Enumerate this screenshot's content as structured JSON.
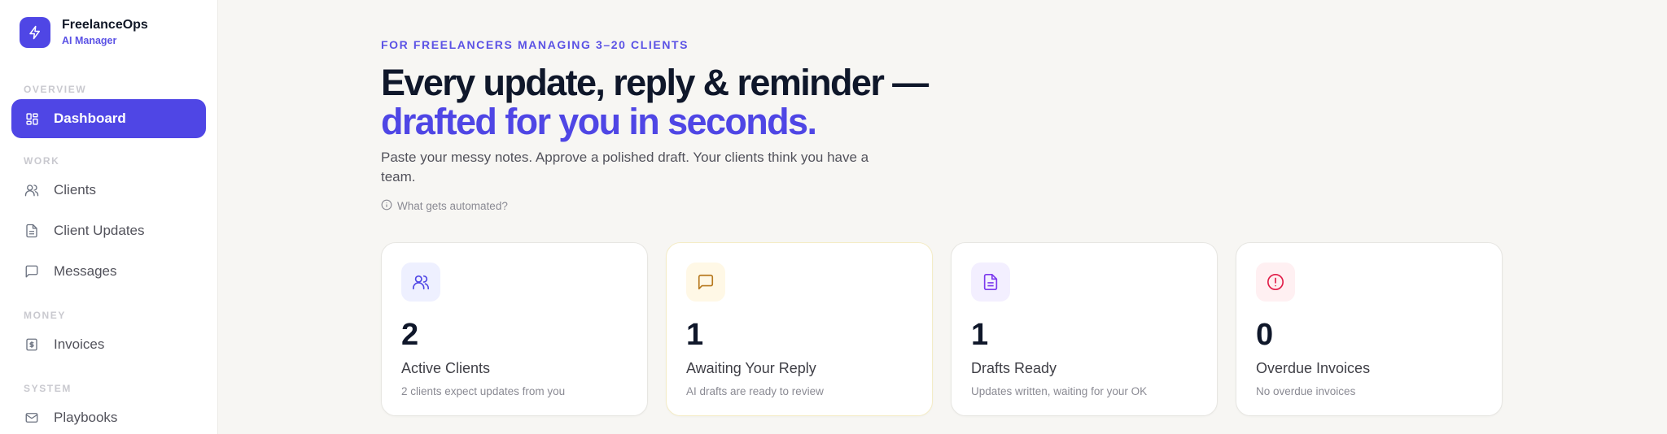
{
  "brand": {
    "name": "FreelanceOps",
    "subtitle": "AI Manager",
    "accent": "#4f46e5"
  },
  "sidebar": {
    "sections": [
      {
        "label": "OVERVIEW",
        "items": [
          {
            "label": "Dashboard",
            "icon": "grid-icon",
            "active": true
          }
        ]
      },
      {
        "label": "WORK",
        "items": [
          {
            "label": "Clients",
            "icon": "users-icon"
          },
          {
            "label": "Client Updates",
            "icon": "document-icon"
          },
          {
            "label": "Messages",
            "icon": "chat-icon"
          }
        ]
      },
      {
        "label": "MONEY",
        "items": [
          {
            "label": "Invoices",
            "icon": "dollar-icon"
          }
        ]
      },
      {
        "label": "SYSTEM",
        "items": [
          {
            "label": "Playbooks",
            "icon": "mail-icon"
          }
        ]
      }
    ]
  },
  "hero": {
    "eyebrow": "FOR FREELANCERS MANAGING 3–20 CLIENTS",
    "headline_line1": "Every update, reply & reminder —",
    "headline_line2": "drafted for you in seconds.",
    "subtext": "Paste your messy notes. Approve a polished draft. Your clients think you have a team.",
    "info_link": "What gets automated?"
  },
  "stats": [
    {
      "value": "2",
      "title": "Active Clients",
      "desc": "2 clients expect updates from you",
      "icon": "users-icon",
      "icon_color": "#4f46e5",
      "icon_bg": "#eef0ff"
    },
    {
      "value": "1",
      "title": "Awaiting Your Reply",
      "desc": "AI drafts are ready to review",
      "icon": "chat-icon",
      "icon_color": "#b7791f",
      "icon_bg": "#fff8e6"
    },
    {
      "value": "1",
      "title": "Drafts Ready",
      "desc": "Updates written, waiting for your OK",
      "icon": "document-icon",
      "icon_color": "#7c3aed",
      "icon_bg": "#f3efff"
    },
    {
      "value": "0",
      "title": "Overdue Invoices",
      "desc": "No overdue invoices",
      "icon": "alert-circle-icon",
      "icon_color": "#e11d48",
      "icon_bg": "#fff0f2"
    }
  ]
}
